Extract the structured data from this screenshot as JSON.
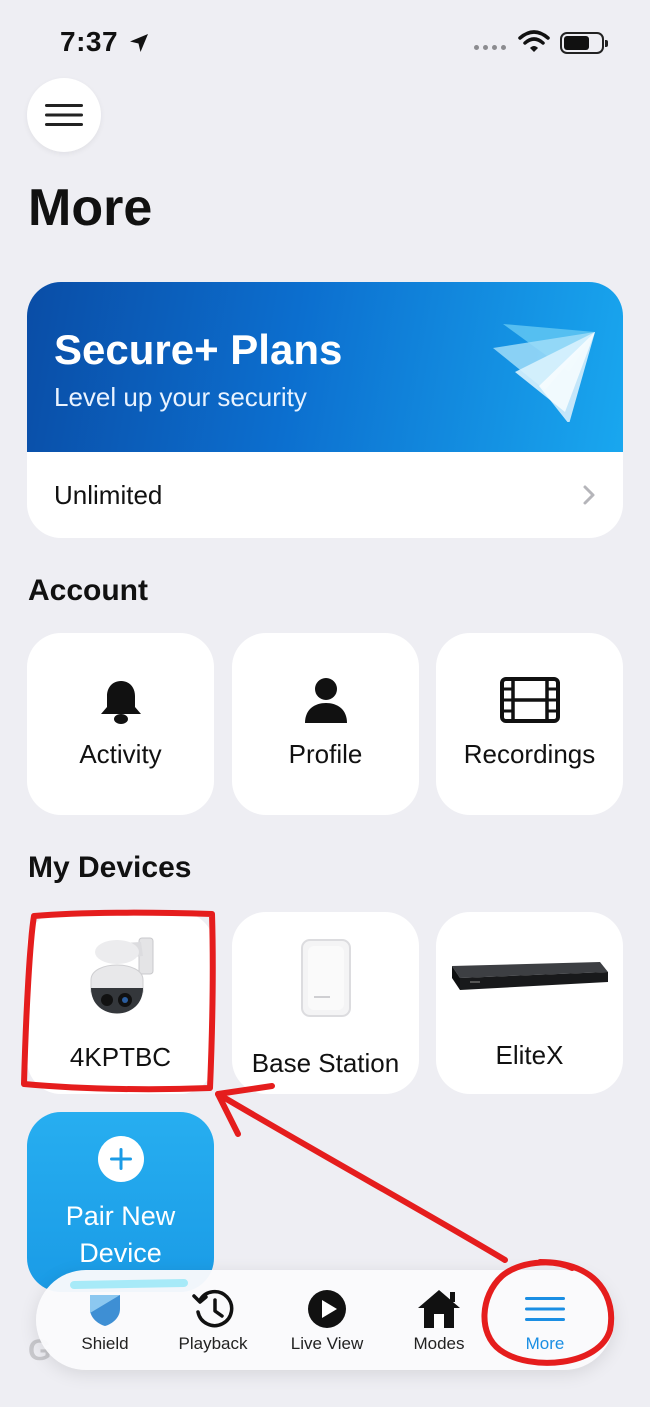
{
  "status_bar": {
    "time": "7:37"
  },
  "page": {
    "title": "More"
  },
  "plan_card": {
    "title": "Secure+ Plans",
    "subtitle": "Level up your security",
    "row_label": "Unlimited"
  },
  "account": {
    "title": "Account",
    "items": [
      {
        "label": "Activity",
        "icon": "bell-icon"
      },
      {
        "label": "Profile",
        "icon": "person-icon"
      },
      {
        "label": "Recordings",
        "icon": "film-icon"
      }
    ]
  },
  "devices": {
    "title": "My Devices",
    "items": [
      {
        "label": "4KPTBC",
        "icon": "ptz-camera-image"
      },
      {
        "label": "Base Station",
        "icon": "base-station-image"
      },
      {
        "label": "EliteX",
        "icon": "nvr-recorder-image"
      }
    ],
    "pair_label": "Pair New Device"
  },
  "tabbar": {
    "tabs": [
      {
        "label": "Shield",
        "icon": "shield-icon"
      },
      {
        "label": "Playback",
        "icon": "history-clock-icon"
      },
      {
        "label": "Live View",
        "icon": "play-circle-icon"
      },
      {
        "label": "Modes",
        "icon": "house-icon"
      },
      {
        "label": "More",
        "icon": "menu-lines-icon",
        "active": true
      }
    ]
  },
  "colors": {
    "background": "#eeeef3",
    "accent": "#1a8ee3",
    "banner_start": "#0a4da6",
    "banner_end": "#19a7ef",
    "annotation_red": "#e51d1d"
  }
}
